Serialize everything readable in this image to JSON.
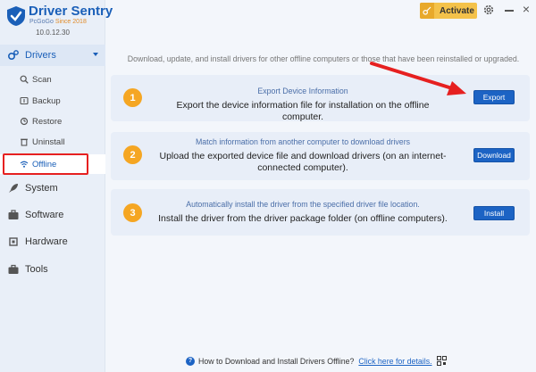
{
  "app": {
    "title": "Driver Sentry",
    "brand": "PcGoGo",
    "since": "Since 2018",
    "version": "10.0.12.30"
  },
  "titlebar": {
    "activate_label": "Activate",
    "icons": [
      "key-icon",
      "gear-icon",
      "minimize-icon",
      "close-icon"
    ]
  },
  "sidebar": {
    "drivers_label": "Drivers",
    "sub_items": [
      {
        "label": "Scan",
        "icon": "scan-icon"
      },
      {
        "label": "Backup",
        "icon": "backup-icon"
      },
      {
        "label": "Restore",
        "icon": "restore-icon"
      },
      {
        "label": "Uninstall",
        "icon": "trash-icon"
      },
      {
        "label": "Offline",
        "icon": "wifi-icon",
        "active": true
      }
    ],
    "sections": [
      {
        "label": "System",
        "icon": "rocket-icon"
      },
      {
        "label": "Software",
        "icon": "briefcase-icon"
      },
      {
        "label": "Hardware",
        "icon": "chip-icon"
      },
      {
        "label": "Tools",
        "icon": "toolbox-icon"
      }
    ]
  },
  "main": {
    "intro": "Download, update, and install drivers for other offline computers or those that have been reinstalled or upgraded.",
    "steps": [
      {
        "num": "1",
        "small": "Export Device Information",
        "big": "Export the device information file for installation on the offline computer.",
        "button": "Export"
      },
      {
        "num": "2",
        "small": "Match information from another computer to download drivers",
        "big": "Upload the exported device file and download drivers (on an internet-connected computer).",
        "button": "Download"
      },
      {
        "num": "3",
        "small": "Automatically install the driver from the specified driver file location.",
        "big": "Install the driver from the driver package folder (on offline computers).",
        "button": "Install"
      }
    ]
  },
  "footer": {
    "question": "How to Download and Install Drivers Offline?",
    "link": "Click here for details."
  },
  "colors": {
    "accent": "#1c63c4",
    "highlight": "#e62020",
    "step_badge": "#f5a623",
    "activate": "#f4c24a"
  }
}
